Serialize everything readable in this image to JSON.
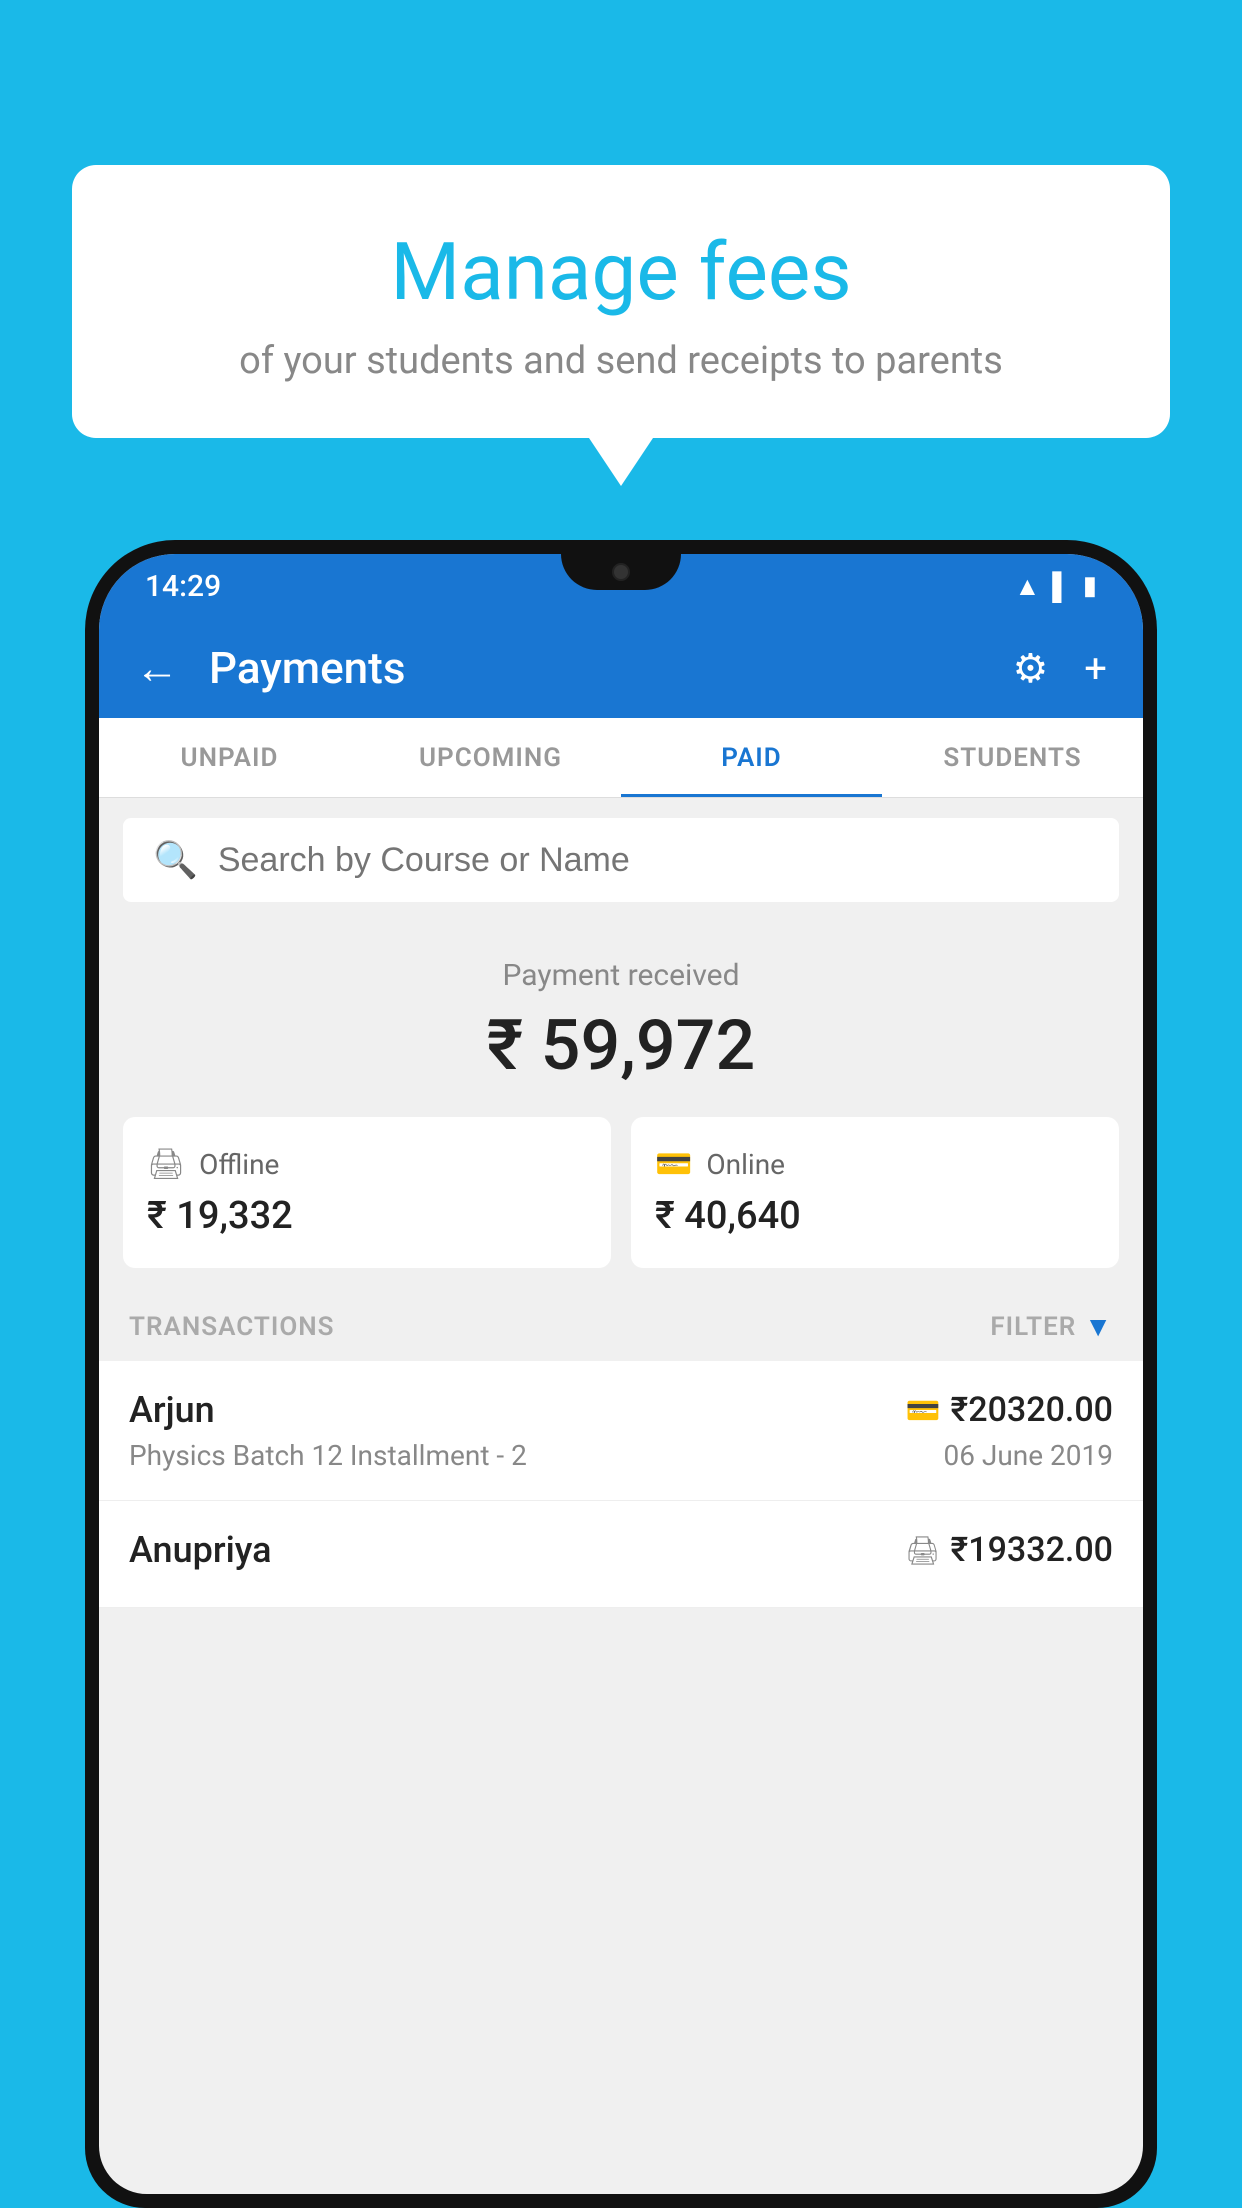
{
  "background_color": "#1ab9e8",
  "speech_bubble": {
    "title": "Manage fees",
    "subtitle": "of your students and send receipts to parents"
  },
  "status_bar": {
    "time": "14:29",
    "icons": [
      "wifi",
      "signal",
      "battery"
    ]
  },
  "app_bar": {
    "title": "Payments",
    "back_label": "←",
    "settings_label": "⚙",
    "add_label": "+"
  },
  "tabs": [
    {
      "label": "UNPAID",
      "active": false
    },
    {
      "label": "UPCOMING",
      "active": false
    },
    {
      "label": "PAID",
      "active": true
    },
    {
      "label": "STUDENTS",
      "active": false
    }
  ],
  "search": {
    "placeholder": "Search by Course or Name"
  },
  "payment_summary": {
    "label": "Payment received",
    "amount": "₹ 59,972",
    "offline": {
      "label": "Offline",
      "amount": "₹ 19,332"
    },
    "online": {
      "label": "Online",
      "amount": "₹ 40,640"
    }
  },
  "transactions_header": {
    "label": "TRANSACTIONS",
    "filter_label": "FILTER"
  },
  "transactions": [
    {
      "name": "Arjun",
      "description": "Physics Batch 12 Installment - 2",
      "amount": "₹20320.00",
      "date": "06 June 2019",
      "payment_type": "online"
    },
    {
      "name": "Anupriya",
      "description": "",
      "amount": "₹19332.00",
      "date": "",
      "payment_type": "offline"
    }
  ]
}
